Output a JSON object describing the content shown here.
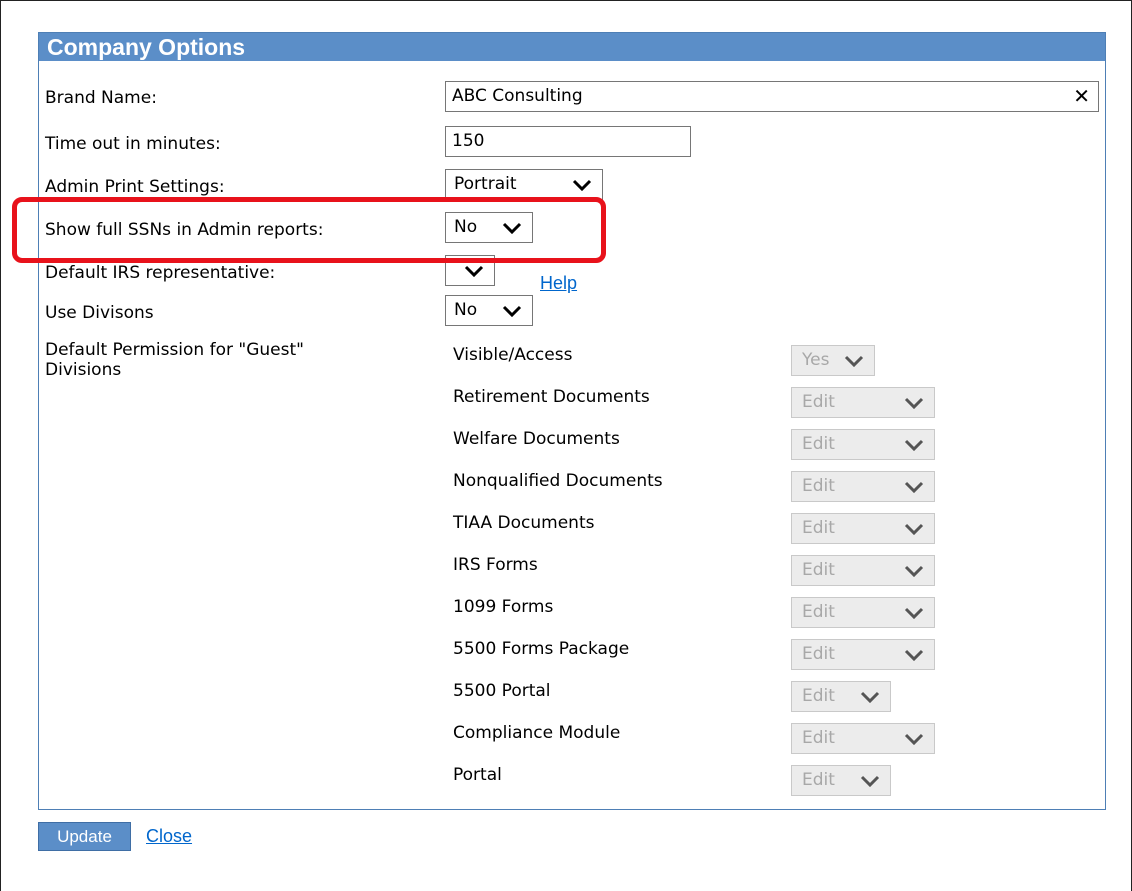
{
  "panel": {
    "title": "Company Options"
  },
  "fields": {
    "brand_name": {
      "label": "Brand Name:",
      "value": "ABC Consulting",
      "clear_icon": "close-icon"
    },
    "timeout": {
      "label": "Time out in minutes:",
      "value": "150"
    },
    "print_settings": {
      "label": "Admin Print Settings:",
      "value": "Portrait"
    },
    "show_ssn": {
      "label": "Show full SSNs in Admin reports:",
      "value": "No"
    },
    "irs_rep": {
      "label": "Default IRS representative:",
      "value": ""
    },
    "use_divisions": {
      "label": "Use Divisons",
      "value": "No",
      "help_label": "Help"
    },
    "guest_permissions": {
      "label_line1": "Default Permission for \"Guest\"",
      "label_line2": "Divisions",
      "items": [
        {
          "label": "Visible/Access",
          "value": "Yes"
        },
        {
          "label": "Retirement Documents",
          "value": "Edit"
        },
        {
          "label": "Welfare Documents",
          "value": "Edit"
        },
        {
          "label": "Nonqualified Documents",
          "value": "Edit"
        },
        {
          "label": "TIAA Documents",
          "value": "Edit"
        },
        {
          "label": "IRS Forms",
          "value": "Edit"
        },
        {
          "label": "1099 Forms",
          "value": "Edit"
        },
        {
          "label": "5500 Forms Package",
          "value": "Edit"
        },
        {
          "label": "5500 Portal",
          "value": "Edit"
        },
        {
          "label": "Compliance Module",
          "value": "Edit"
        },
        {
          "label": "Portal",
          "value": "Edit"
        }
      ]
    }
  },
  "footer": {
    "update_label": "Update",
    "close_label": "Close"
  },
  "colors": {
    "header": "#5b8ec8",
    "highlight": "#e8121b",
    "link": "#0066cc"
  }
}
